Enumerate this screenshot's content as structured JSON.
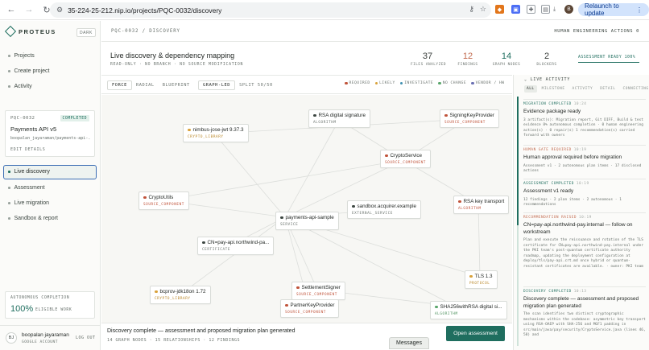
{
  "browser": {
    "url": "35-224-25-212.nip.io/projects/PQC-0032/discovery",
    "relaunch_label": "Relaunch to update",
    "profile_initial": "B"
  },
  "sidebar": {
    "brand": "PROTEUS",
    "theme_toggle": "DARK",
    "links": [
      {
        "label": "Projects"
      },
      {
        "label": "Create project"
      },
      {
        "label": "Activity"
      }
    ],
    "project": {
      "id": "PQC-0032",
      "status": "COMPLETED",
      "name": "Payments API v5",
      "owner": "boopalan_jayaraman/payments-api-...",
      "edit_label": "EDIT DETAILS"
    },
    "phases": [
      {
        "label": "Live discovery",
        "active": true
      },
      {
        "label": "Assessment"
      },
      {
        "label": "Live migration"
      },
      {
        "label": "Sandbox & report"
      }
    ],
    "autonomous": {
      "label": "AUTONOMOUS COMPLETION",
      "percent": "100%",
      "sub": "ELIGIBLE WORK"
    },
    "user": {
      "initials": "BJ",
      "name": "boopalan jayaraman",
      "account": "GOOGLE ACCOUNT",
      "logout": "LOG OUT"
    }
  },
  "header": {
    "breadcrumb": "PQC-0032 / DISCOVERY",
    "human_actions": "HUMAN ENGINEERING ACTIONS 0",
    "title": "Live discovery & dependency mapping",
    "subtitle": "READ-ONLY · NO BRANCH · NO SOURCE MODIFICATION",
    "stats": [
      {
        "value": "37",
        "label": "FILES ANALYZED",
        "color": "#3a3f3c"
      },
      {
        "value": "12",
        "label": "FINDINGS",
        "color": "#c26a4e"
      },
      {
        "value": "14",
        "label": "GRAPH NODES",
        "color": "#1f6e5f"
      },
      {
        "value": "2",
        "label": "BLOCKERS",
        "color": "#3a3f3c"
      }
    ],
    "assessment_ready": "ASSESSMENT READY  100%"
  },
  "toolbar": {
    "layout_modes": [
      "FORCE",
      "RADIAL",
      "BLUEPRINT"
    ],
    "view_modes": [
      "GRAPH-LED",
      "SPLIT 50/50"
    ],
    "legend": [
      {
        "label": "REQUIRED",
        "color": "#c0533a"
      },
      {
        "label": "LIKELY",
        "color": "#d9a23a"
      },
      {
        "label": "INVESTIGATE",
        "color": "#3f8fb0"
      },
      {
        "label": "NO CHANGE",
        "color": "#5aa66b"
      },
      {
        "label": "VENDOR / HW",
        "color": "#6a6fb3"
      }
    ]
  },
  "graph": {
    "nodes": [
      {
        "name": "nimbus-jose-jwt 9.37.3",
        "type": "CRYPTO_LIBRARY",
        "color": "#d9a23a"
      },
      {
        "name": "RSA digital signature",
        "type": "ALGORITHM",
        "color": "#3d4742"
      },
      {
        "name": "SigningKeyProvider",
        "type": "SOURCE_COMPONENT",
        "color": "#c0533a"
      },
      {
        "name": "CryptoService",
        "type": "SOURCE_COMPONENT",
        "color": "#c0533a"
      },
      {
        "name": "CryptoUtils",
        "type": "SOURCE_COMPONENT",
        "color": "#c0533a"
      },
      {
        "name": "payments-api-sample",
        "type": "SERVICE",
        "color": "#3d4742"
      },
      {
        "name": "sandbox.acquirer.example",
        "type": "EXTERNAL_SERVICE",
        "color": "#3d4742"
      },
      {
        "name": "RSA key transport",
        "type": "ALGORITHM",
        "color": "#c0533a"
      },
      {
        "name": "CN=pay-api.northwind-pa...",
        "type": "CERTIFICATE",
        "color": "#3d4742"
      },
      {
        "name": "bcprov-jdk18on 1.72",
        "type": "CRYPTO_LIBRARY",
        "color": "#d9a23a"
      },
      {
        "name": "SettlementSigner",
        "type": "SOURCE_COMPONENT",
        "color": "#c0533a"
      },
      {
        "name": "PartnerKeyProvider",
        "type": "SOURCE_COMPONENT",
        "color": "#c0533a"
      },
      {
        "name": "TLS 1.3",
        "type": "PROTOCOL",
        "color": "#d9a23a"
      },
      {
        "name": "SHA256withRSA digital si...",
        "type": "ALGORITHM",
        "color": "#5aa66b"
      }
    ]
  },
  "banner": {
    "title": "Discovery complete — assessment and proposed migration plan generated",
    "summary": "14 GRAPH NODES · 15 RELATIONSHIPS · 12 FINDINGS",
    "cta": "Open assessment",
    "messages": "Messages"
  },
  "activity": {
    "header": "LIVE ACTIVITY",
    "tabs": [
      "ALL",
      "MILESTONE",
      "ACTIVITY",
      "DETAIL",
      "CONNECTING"
    ],
    "cards": [
      {
        "tag": "MIGRATION COMPLETED",
        "time": "10:24",
        "tag_color": "#1f6e5f",
        "title": "Evidence package ready",
        "body": "3 artifact(s): Migration report, Git DIFF, Build & test evidence 8% autonomous completion · 0 human engineering action(s) · 0 repair(s) 1 recommendation(s) carried forward with owners"
      },
      {
        "tag": "HUMAN GATE REQUIRED",
        "time": "10:19",
        "tag_color": "#c26a4e",
        "title": "Human approval required before migration",
        "body": "Assessment v1 · 2 autonomous plan items · 17 disclosed actions"
      },
      {
        "tag": "ASSESSMENT COMPLETED",
        "time": "10:19",
        "tag_color": "#1f6e5f",
        "title": "Assessment v1 ready",
        "body": "12 findings · 2 plan items · 2 autonomous · 1 recommendations"
      },
      {
        "tag": "RECOMMENDATION RAISED",
        "time": "10:19",
        "tag_color": "#c26a4e",
        "title": "CN=pay-api.northwind-pay.internal — follow on workstream",
        "body": "Plan and execute the reissuance and rotation of the TLS certificate for CN=pay-api.northwind-pay.internal under the PKI team's post-quantum certificate authority roadmap, updating the deployment configuration at deploy/tls/pay-api.crt.md once hybrid or quantum-resistant certificates are available. · owner: PKI team"
      },
      {
        "tag": "DISCOVERY COMPLETED",
        "time": "10:13",
        "tag_color": "#1f6e5f",
        "title": "Discovery complete — assessment and proposed migration plan generated",
        "body": "The scan identifies two distinct cryptographic mechanisms within the codebase: asymmetric key transport using RSA-OAEP with SHA-256 and MGF1 padding in src/main/java/pay/security/CryptoService.java (lines 46, 58) and"
      }
    ]
  }
}
